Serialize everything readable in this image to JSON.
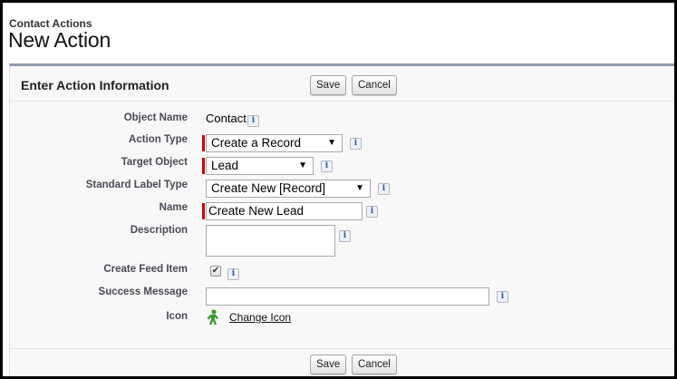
{
  "header": {
    "subtitle": "Contact Actions",
    "title": "New Action"
  },
  "panel": {
    "title": "Enter Action Information",
    "save_label": "Save",
    "cancel_label": "Cancel"
  },
  "form": {
    "object_name": {
      "label": "Object Name",
      "value": "Contact",
      "info": "i"
    },
    "action_type": {
      "label": "Action Type",
      "value": "Create a Record",
      "arrow": "▼",
      "info": "i"
    },
    "target_object": {
      "label": "Target Object",
      "value": "Lead",
      "arrow": "▼",
      "info": "i"
    },
    "standard_label_type": {
      "label": "Standard Label Type",
      "value": "Create New [Record]",
      "arrow": "▼",
      "info": "i"
    },
    "name": {
      "label": "Name",
      "value": "Create New Lead",
      "info": "i"
    },
    "description": {
      "label": "Description",
      "value": "",
      "info": "i"
    },
    "create_feed_item": {
      "label": "Create Feed Item",
      "checked": true,
      "check_glyph": "✔",
      "info": "i"
    },
    "success_message": {
      "label": "Success Message",
      "value": "",
      "info": "i"
    },
    "icon": {
      "label": "Icon",
      "icon_name": "person-icon",
      "icon_color": "#3c9a2e",
      "link_label": "Change Icon"
    }
  },
  "footer": {
    "save_label": "Save",
    "cancel_label": "Cancel"
  },
  "colors": {
    "required_bar": "#cc0000",
    "panel_border": "#8e9bae",
    "info_icon": "#2c5ea0"
  }
}
